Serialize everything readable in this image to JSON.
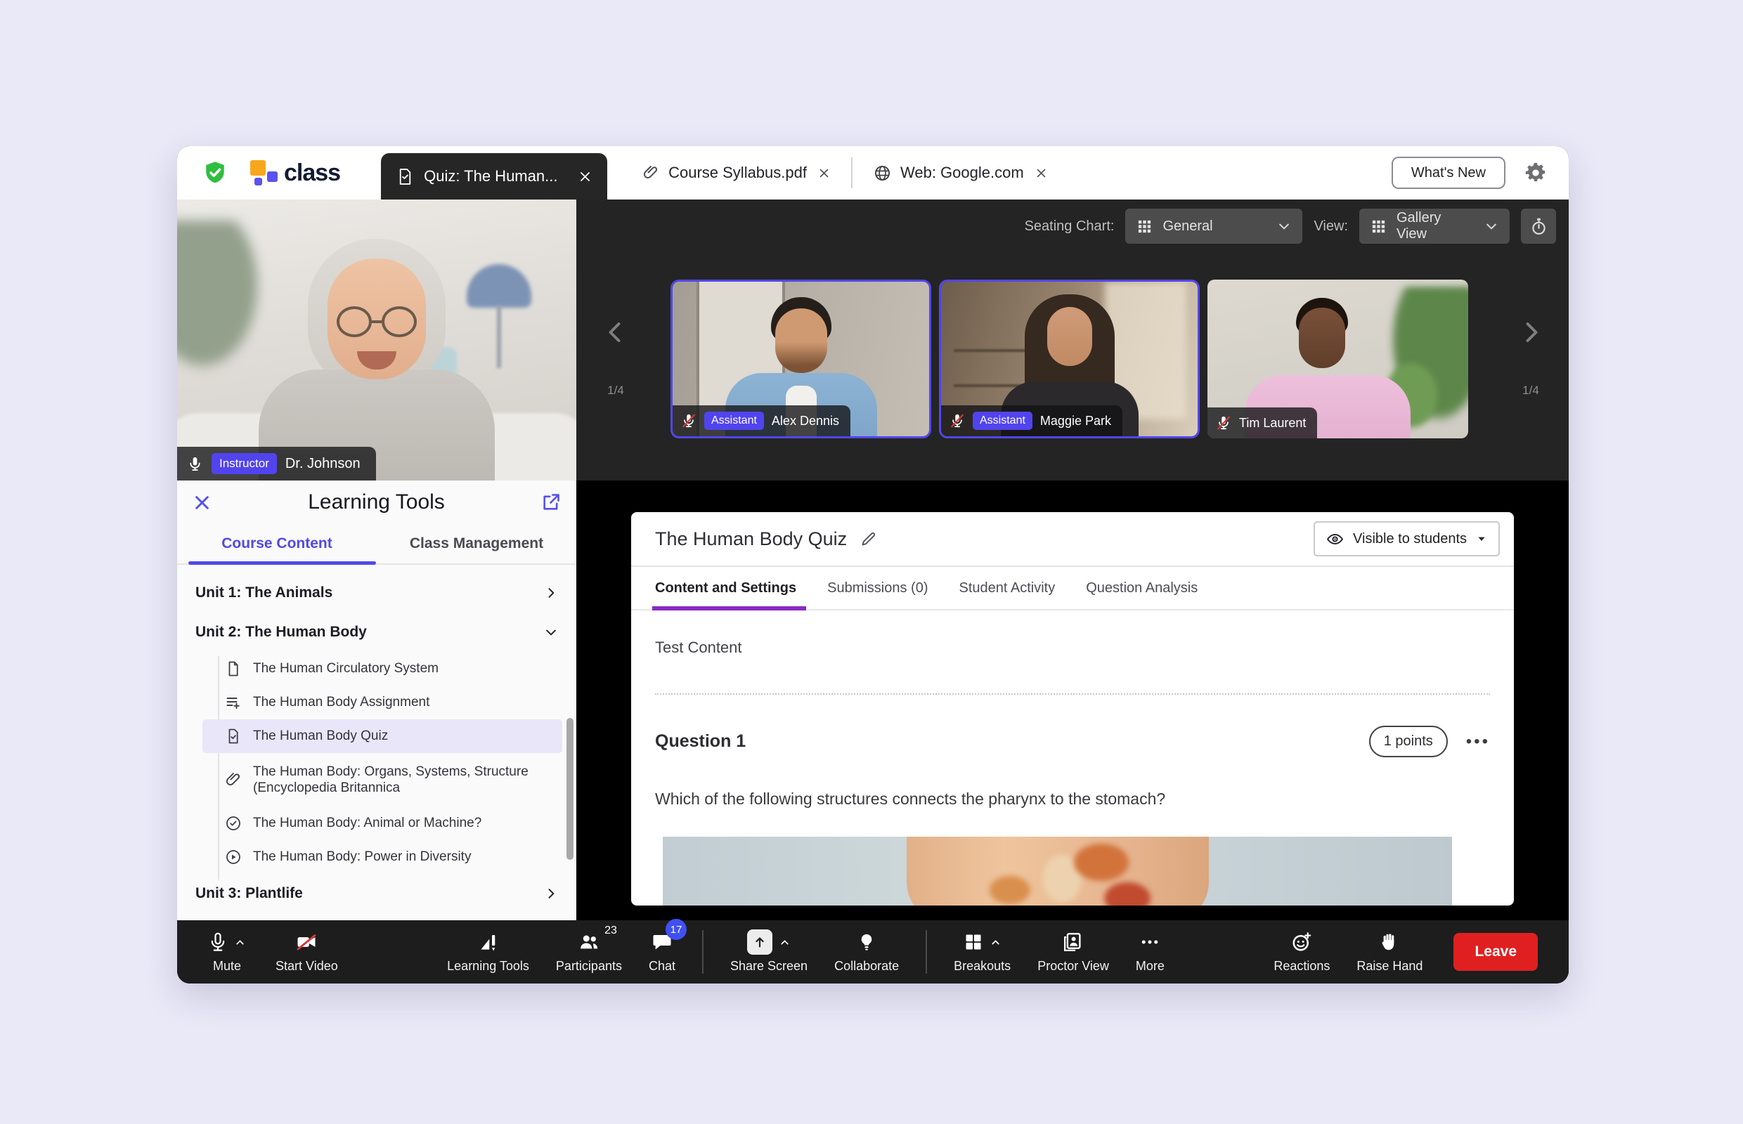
{
  "topbar": {
    "brand": "class",
    "tabs": [
      {
        "label": "Quiz: The Human..."
      },
      {
        "label": "Course Syllabus.pdf"
      },
      {
        "label": "Web: Google.com"
      }
    ],
    "whats_new": "What's New"
  },
  "instructor": {
    "badge": "Instructor",
    "name": "Dr. Johnson"
  },
  "strip": {
    "seating_chart_label": "Seating Chart:",
    "seating_chart_value": "General",
    "view_label": "View:",
    "view_value": "Gallery View",
    "pager": "1/4"
  },
  "tiles": [
    {
      "badge": "Assistant",
      "name": "Alex Dennis"
    },
    {
      "badge": "Assistant",
      "name": "Maggie Park"
    },
    {
      "name": "Tim Laurent"
    }
  ],
  "learning_tools": {
    "title": "Learning Tools",
    "tab_course": "Course Content",
    "tab_class": "Class Management",
    "unit1": "Unit 1: The Animals",
    "unit2": "Unit 2: The Human Body",
    "unit3": "Unit 3: Plantlife",
    "items": [
      {
        "label": "The Human Circulatory System"
      },
      {
        "label": "The Human Body Assignment"
      },
      {
        "label": "The Human Body Quiz"
      },
      {
        "label": "The Human Body: Organs, Systems, Structure (Encyclopedia Britannica"
      },
      {
        "label": "The Human Body: Animal or Machine?"
      },
      {
        "label": "The Human Body: Power in Diversity"
      }
    ]
  },
  "quiz": {
    "title": "The Human Body Quiz",
    "visibility": "Visible to students",
    "tabs": [
      "Content and Settings",
      "Submissions (0)",
      "Student Activity",
      "Question Analysis"
    ],
    "content_label": "Test Content",
    "question_label": "Question 1",
    "points": "1 points",
    "menu_glyph": "•••",
    "question_text": "Which of the following structures connects the pharynx to the stomach?"
  },
  "toolbar": {
    "mute": "Mute",
    "start_video": "Start Video",
    "learning_tools": "Learning Tools",
    "participants": "Participants",
    "participants_count": "23",
    "chat": "Chat",
    "chat_badge": "17",
    "share_screen": "Share Screen",
    "collaborate": "Collaborate",
    "breakouts": "Breakouts",
    "proctor_view": "Proctor View",
    "more": "More",
    "reactions": "Reactions",
    "raise_hand": "Raise Hand",
    "leave": "Leave"
  },
  "colors": {
    "accent_purple": "#5a52ee",
    "quiz_tab_underline": "#8a2bc2",
    "leave_red": "#e02020",
    "chat_badge_blue": "#4050f0",
    "shield_green": "#2fbe3f",
    "brand_yellow": "#f6a71b",
    "selected_item_bg": "#e9e6fa"
  }
}
